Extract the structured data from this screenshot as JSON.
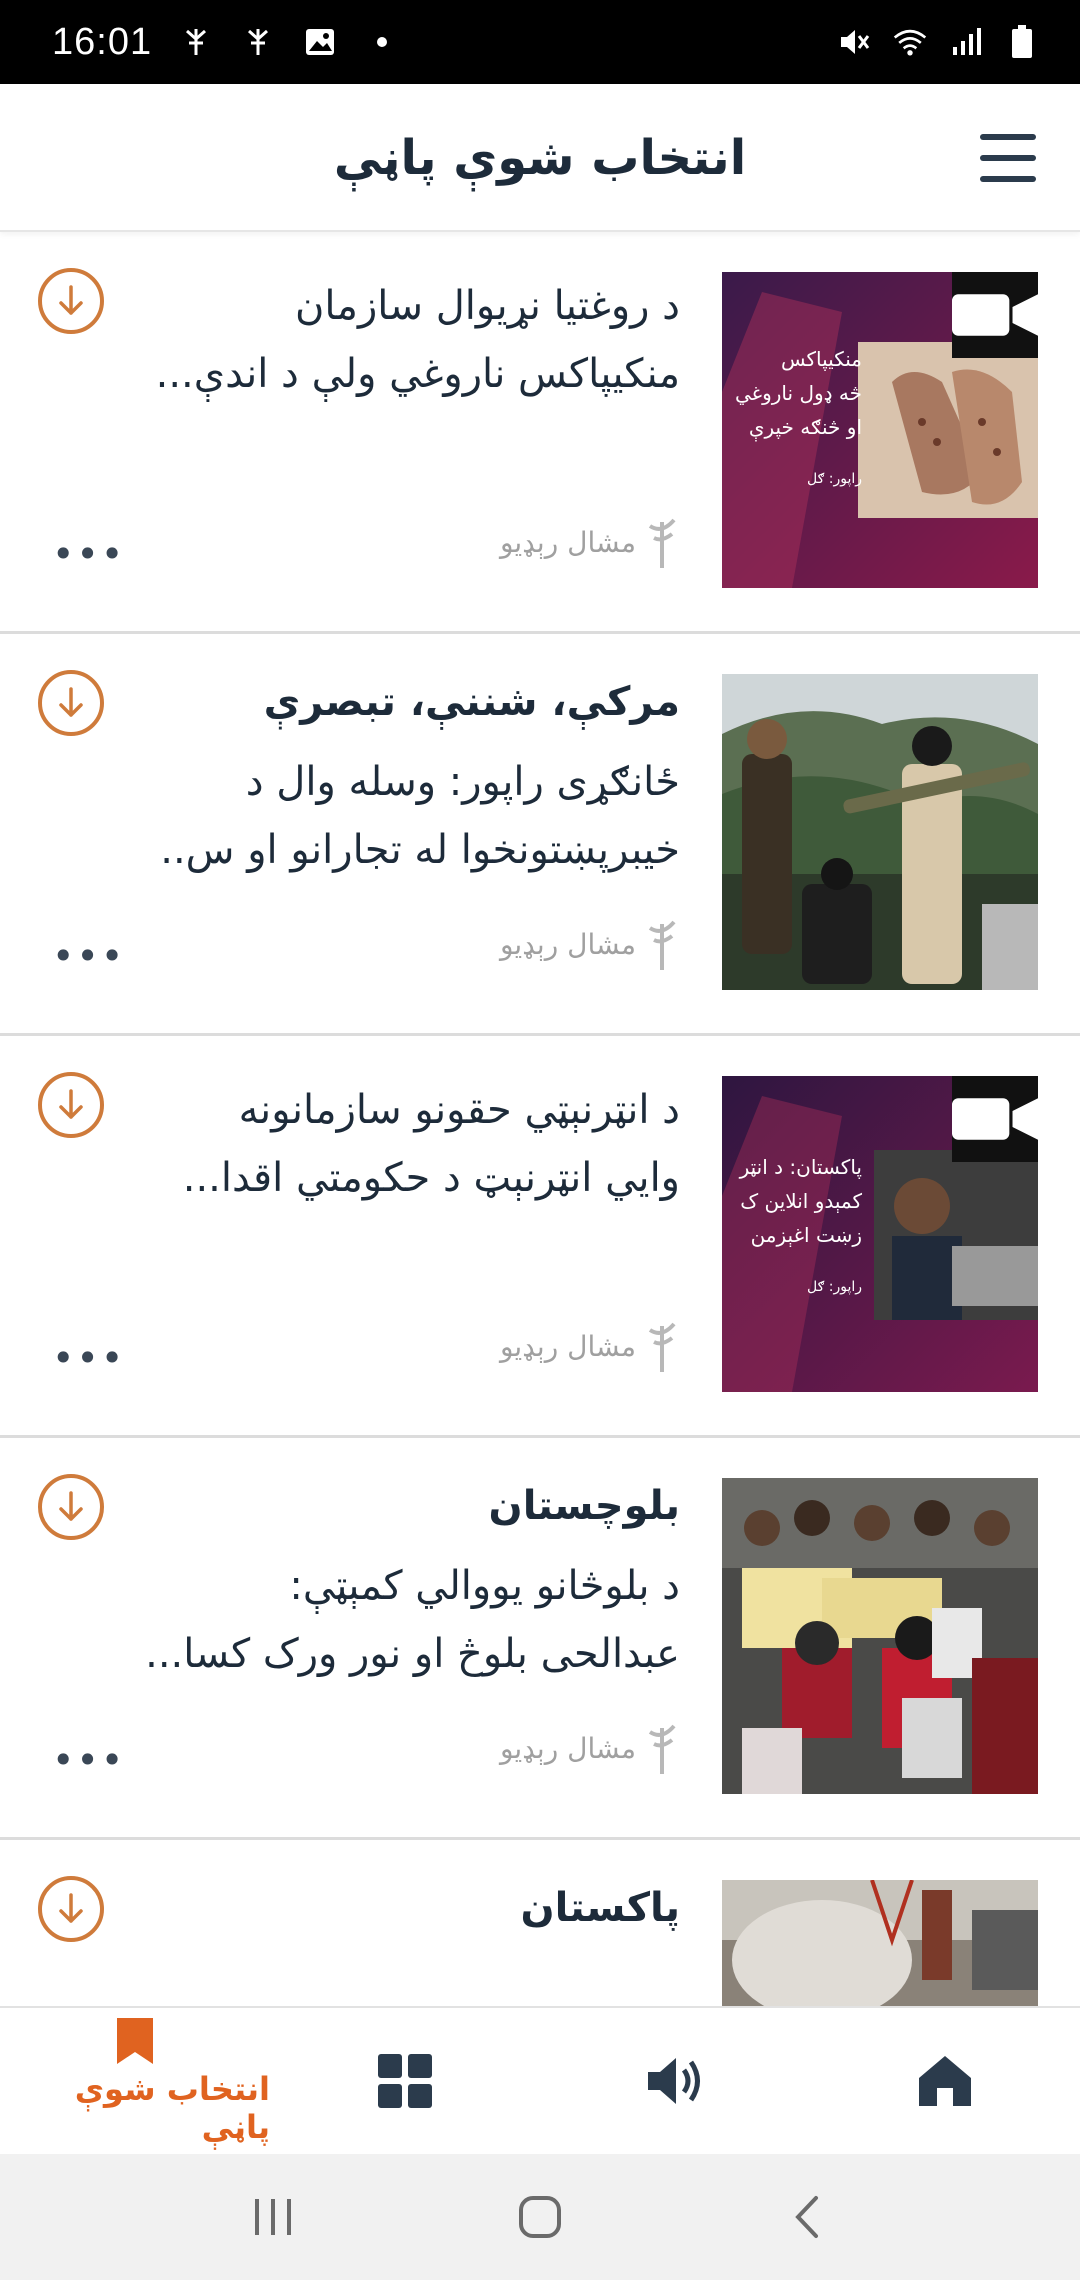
{
  "status_bar": {
    "time": "16:01",
    "left_icons": [
      "signal-antenna-icon",
      "signal-antenna-icon",
      "image-icon",
      "dot-icon"
    ],
    "right_icons": [
      "mute-icon",
      "wifi-icon",
      "cell-signal-icon",
      "battery-icon"
    ]
  },
  "header": {
    "title": "انتخاب شوې پاڼې",
    "menu_icon": "hamburger-menu-icon"
  },
  "items": [
    {
      "category": "",
      "title_line1": "د روغتیا نړیوال سازمان",
      "title_line2": "منکیپاکس ناروغي ولې د اندې...",
      "source": "مشال رېډیو",
      "has_video": true,
      "thumb_text": [
        "منکیپاکس",
        "څه ډول ناروغي",
        "او څنګه خپرې",
        "راپور: ګل"
      ]
    },
    {
      "category": "مرکې، شننې، تبصرې",
      "title_line1": "ځانګړی راپور: وسله وال د",
      "title_line2": "خیبرپښتونخوا له تجارانو او س..",
      "source": "مشال رېډیو",
      "has_video": false
    },
    {
      "category": "",
      "title_line1": "د انټرنېټي حقونو سازمانونه",
      "title_line2": "وايي انټرنېټ د حکومتي اقدا...",
      "source": "مشال رېډیو",
      "has_video": true,
      "thumb_text": [
        "پاکستان: د انټر",
        "کمېدو انلاین ک",
        "زښت اغېزمن",
        "راپور: ګل"
      ]
    },
    {
      "category": "بلوچستان",
      "title_line1": "د بلوڅانو یووالي کمېټې:",
      "title_line2": "عبدالحی بلوڅ او نور ورک کسا...",
      "source": "مشال رېډیو",
      "has_video": false
    },
    {
      "category": "پاکستان",
      "title_line1": "",
      "title_line2": "",
      "source": "",
      "has_video": false
    }
  ],
  "bottom_nav": {
    "active_label": "انتخاب شوې پاڼې",
    "items": [
      "bookmark-icon",
      "grid-icon",
      "speaker-icon",
      "home-icon"
    ]
  },
  "colors": {
    "accent": "#e06320",
    "download_ring": "#cf7b3b",
    "text_dark": "#1d2b3a"
  }
}
